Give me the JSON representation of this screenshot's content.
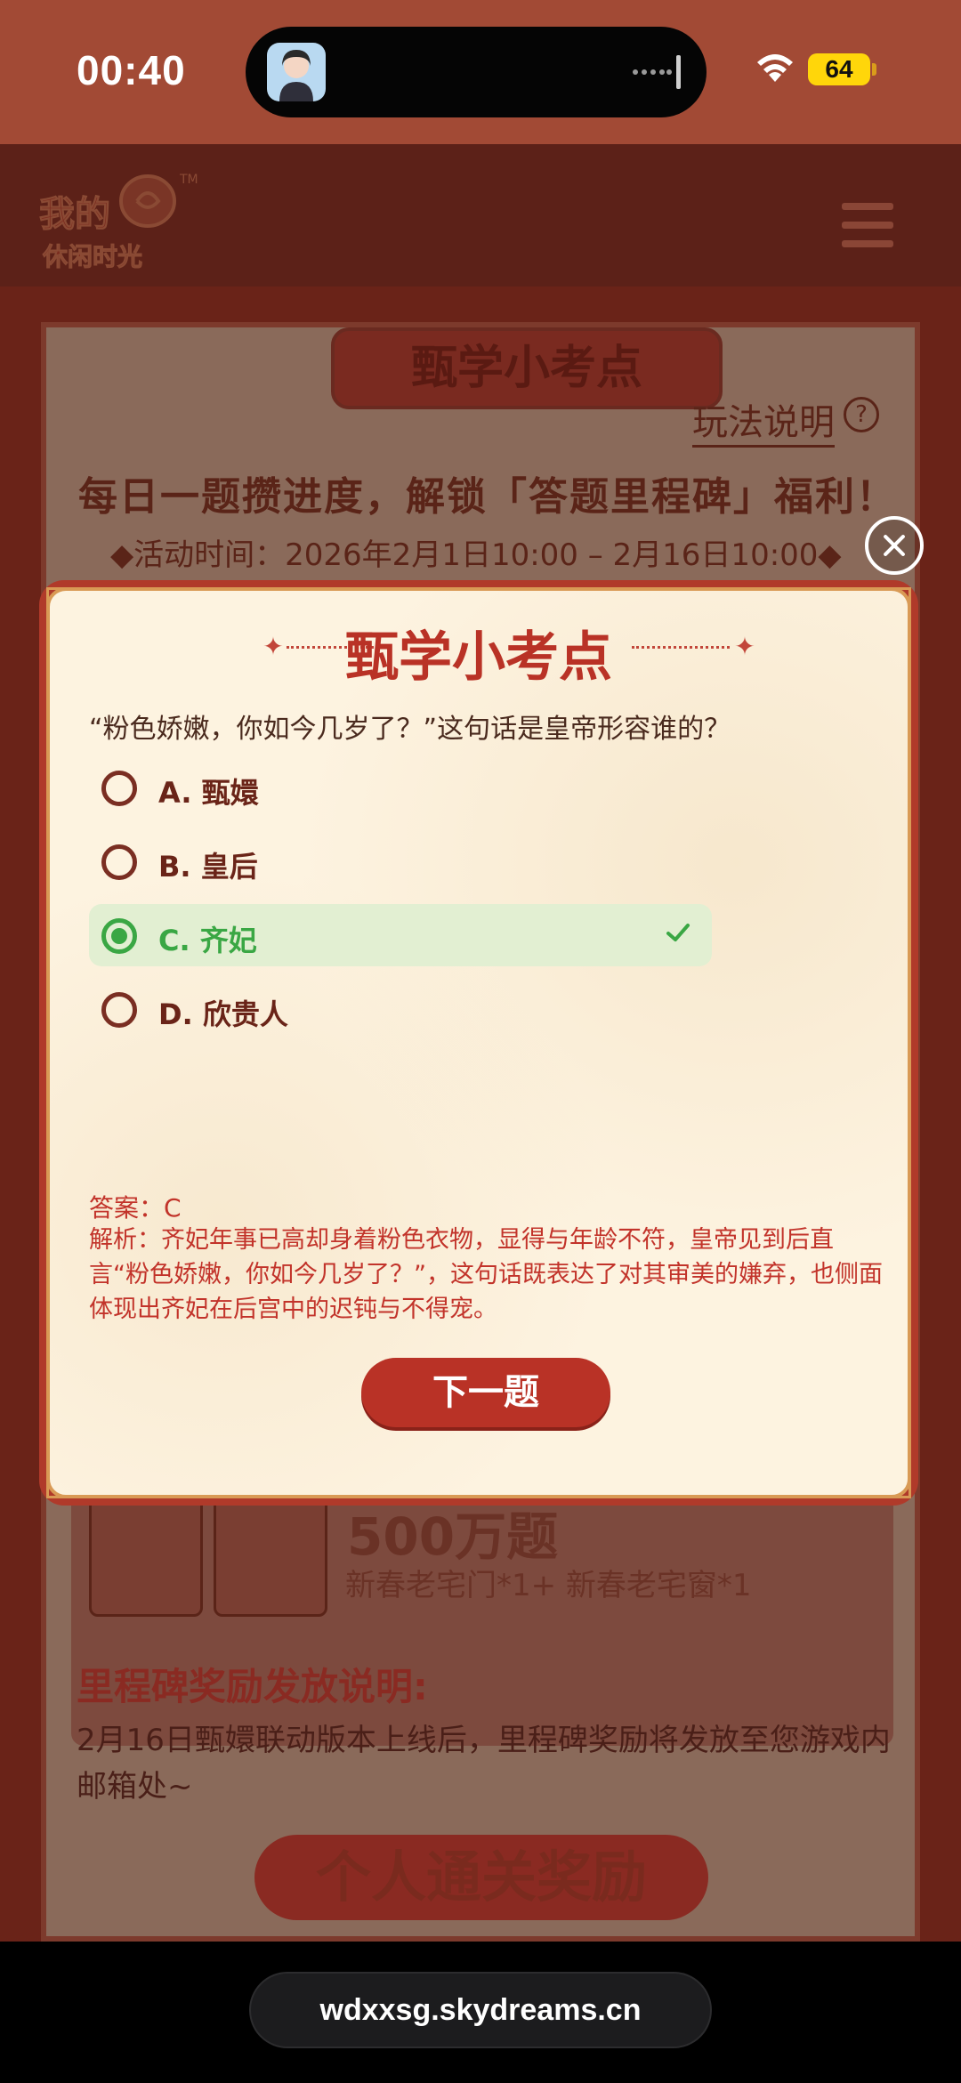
{
  "status_bar": {
    "time": "00:40",
    "battery": "64"
  },
  "header": {
    "logo_icon": "snail-logo-icon",
    "menu_icon": "hamburger-menu-icon"
  },
  "background": {
    "banner": "甄学小考点",
    "rules_link": "玩法说明",
    "rules_icon": "?",
    "headline": "每日一题攒进度，解锁「答题里程碑」福利！",
    "activity_time": "◆活动时间：2026年2月1日10:00 – 2月16日10:00◆",
    "milestone_count": "500万题",
    "milestone_rewards": "新春老宅门*1+ 新春老宅窗*1",
    "milestone_title": "里程碑奖励发放说明:",
    "milestone_text": "2月16日甄嬛联动版本上线后，里程碑奖励将发放至您游戏内邮箱处~",
    "section_ribbon": "个人通关奖励"
  },
  "quiz": {
    "title": "甄学小考点",
    "question": "“粉色娇嫩，你如今几岁了？”这句话是皇帝形容谁的？",
    "options": [
      {
        "label": "A. 甄嬛",
        "selected": false
      },
      {
        "label": "B. 皇后",
        "selected": false
      },
      {
        "label": "C. 齐妃",
        "selected": true,
        "correct": true
      },
      {
        "label": "D. 欣贵人",
        "selected": false
      }
    ],
    "answer": "答案：C",
    "analysis": "解析：齐妃年事已高却身着粉色衣物，显得与年龄不符，皇帝见到后直言“粉色娇嫩，你如今几岁了？”，这句话既表达了对其审美的嫌弃，也侧面体现出齐妃在后宫中的迟钝与不得宠。",
    "next_button": "下一题",
    "close_icon": "close-icon",
    "correct_color": "#3aa744",
    "accent_color": "#b93226"
  },
  "browser": {
    "url": "wdxxsg.skydreams.cn"
  }
}
